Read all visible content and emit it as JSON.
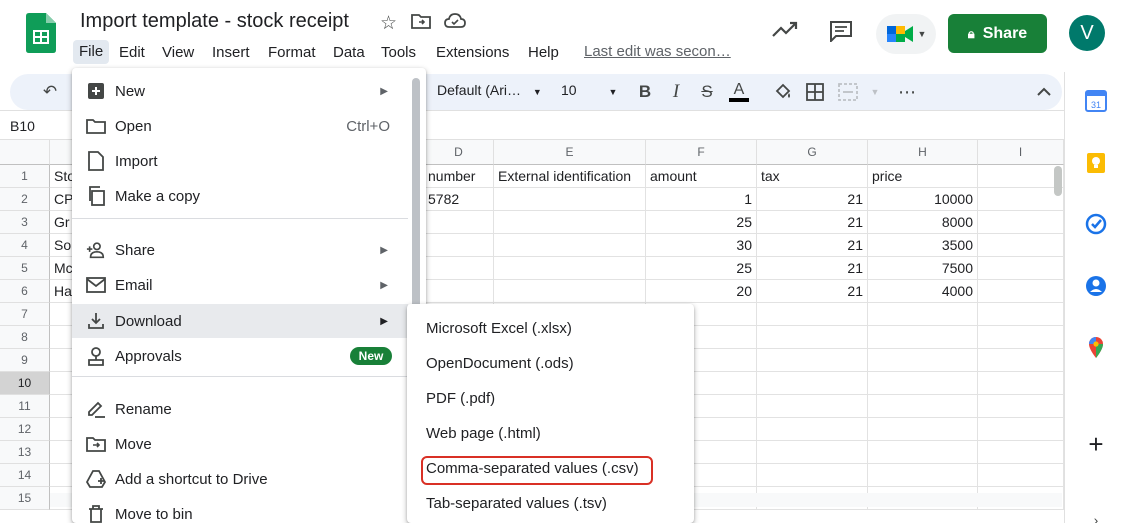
{
  "header": {
    "title": "Import template - stock receipt",
    "menu": [
      "File",
      "Edit",
      "View",
      "Insert",
      "Format",
      "Data",
      "Tools",
      "Extensions",
      "Help"
    ],
    "last_edit": "Last edit was secon…",
    "share_label": "Share",
    "avatar_letter": "V",
    "accent_color": "#188038"
  },
  "toolbar": {
    "font": "Default (Ari…",
    "font_size": "10"
  },
  "name_box": "B10",
  "grid": {
    "columns": [
      {
        "letter": "",
        "id": "A"
      },
      {
        "letter": "D",
        "id": "D"
      },
      {
        "letter": "E",
        "id": "E"
      },
      {
        "letter": "F",
        "id": "F"
      },
      {
        "letter": "G",
        "id": "G"
      },
      {
        "letter": "H",
        "id": "H"
      },
      {
        "letter": "I",
        "id": "I"
      }
    ],
    "rows": [
      "1",
      "2",
      "3",
      "4",
      "5",
      "6",
      "7",
      "8",
      "9",
      "10",
      "11",
      "12",
      "13",
      "14",
      "15"
    ],
    "col_a_values": [
      "Sto",
      "CP",
      "Gr",
      "So",
      "Mc",
      "Ha"
    ],
    "col_d_values": [
      "number",
      "5782"
    ],
    "headers_row": {
      "E": "External identification",
      "F": "amount",
      "G": "tax",
      "H": "price"
    },
    "data": [
      {
        "F": "1",
        "G": "21",
        "H": "10000"
      },
      {
        "F": "25",
        "G": "21",
        "H": "8000"
      },
      {
        "F": "30",
        "G": "21",
        "H": "3500"
      },
      {
        "F": "25",
        "G": "21",
        "H": "7500"
      },
      {
        "F": "20",
        "G": "21",
        "H": "4000"
      }
    ]
  },
  "file_menu": {
    "items": [
      {
        "label": "New",
        "icon": "new-sheet-icon",
        "submenu": true
      },
      {
        "label": "Open",
        "icon": "folder-open-icon",
        "shortcut": "Ctrl+O"
      },
      {
        "label": "Import",
        "icon": "import-icon"
      },
      {
        "label": "Make a copy",
        "icon": "copy-icon"
      },
      {
        "label": "Share",
        "icon": "person-add-icon",
        "submenu": true
      },
      {
        "label": "Email",
        "icon": "email-icon",
        "submenu": true
      },
      {
        "label": "Download",
        "icon": "download-icon",
        "submenu": true
      },
      {
        "label": "Approvals",
        "icon": "approvals-icon",
        "badge": "New"
      },
      {
        "label": "Rename",
        "icon": "rename-icon"
      },
      {
        "label": "Move",
        "icon": "move-icon"
      },
      {
        "label": "Add a shortcut to Drive",
        "icon": "drive-shortcut-icon"
      },
      {
        "label": "Move to bin",
        "icon": "trash-icon"
      }
    ]
  },
  "download_menu": {
    "items": [
      {
        "label": "Microsoft Excel (.xlsx)"
      },
      {
        "label": "OpenDocument (.ods)"
      },
      {
        "label": "PDF (.pdf)"
      },
      {
        "label": "Web page (.html)"
      },
      {
        "label": "Comma-separated values (.csv)"
      },
      {
        "label": "Tab-separated values (.tsv)"
      }
    ],
    "highlight_color": "#d93025"
  }
}
